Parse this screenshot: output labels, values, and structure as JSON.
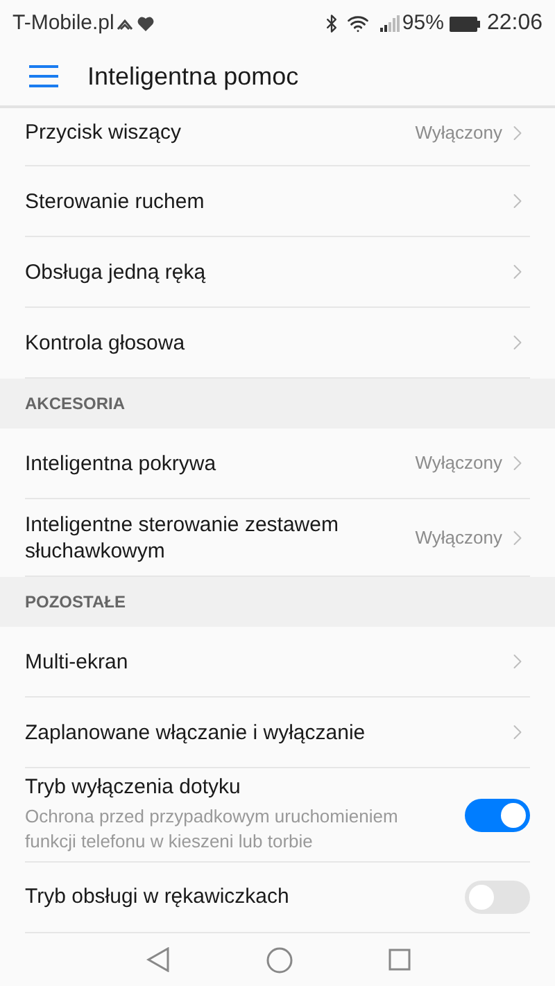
{
  "status_bar": {
    "carrier": "T-Mobile.pl",
    "battery": "95%",
    "time": "22:06"
  },
  "app_bar": {
    "title": "Inteligentna pomoc"
  },
  "sections": [
    {
      "items": [
        {
          "kind": "link",
          "label": "Przycisk wiszący",
          "value": "Wyłączony"
        },
        {
          "kind": "link",
          "label": "Sterowanie ruchem"
        },
        {
          "kind": "link",
          "label": "Obsługa jedną ręką"
        },
        {
          "kind": "link",
          "label": "Kontrola głosowa"
        }
      ]
    },
    {
      "header": "AKCESORIA",
      "items": [
        {
          "kind": "link",
          "label": "Inteligentna pokrywa",
          "value": "Wyłączony"
        },
        {
          "kind": "link",
          "label": "Inteligentne sterowanie zestawem słuchawkowym",
          "value": "Wyłączony"
        }
      ]
    },
    {
      "header": "POZOSTAŁE",
      "items": [
        {
          "kind": "link",
          "label": "Multi-ekran"
        },
        {
          "kind": "link",
          "label": "Zaplanowane włączanie i wyłączanie"
        },
        {
          "kind": "toggle",
          "label": "Tryb wyłączenia dotyku",
          "description": "Ochrona przed przypadkowym uruchomieniem funkcji telefonu w kieszeni lub torbie",
          "on": true
        },
        {
          "kind": "toggle",
          "label": "Tryb obsługi w rękawiczkach",
          "on": false
        }
      ]
    }
  ]
}
